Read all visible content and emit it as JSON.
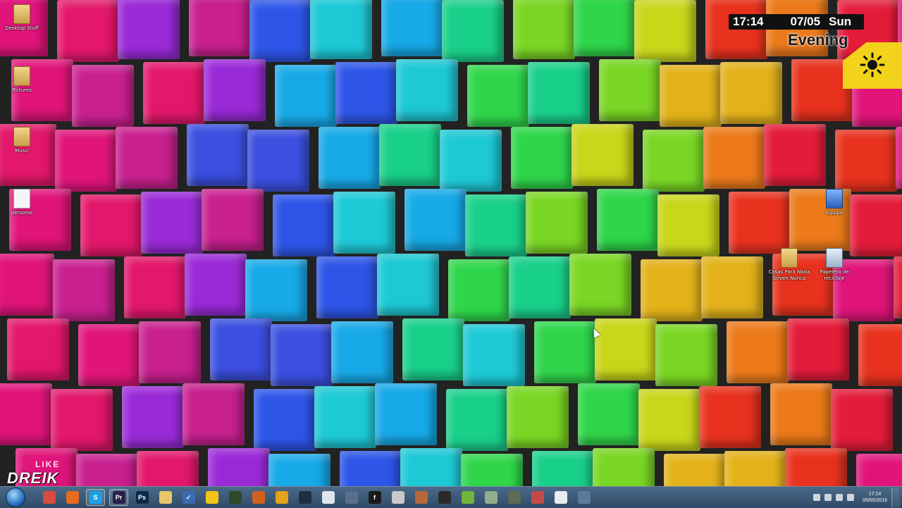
{
  "desktop": {
    "icons_left": [
      {
        "label": "Desktop Stuff",
        "icon": "folder-icon"
      },
      {
        "label": "Pictures",
        "icon": "folder-icon"
      },
      {
        "label": "Music",
        "icon": "folder-icon"
      },
      {
        "label": "personal",
        "icon": "document-icon"
      }
    ],
    "icons_right": [
      {
        "label": "Equipo",
        "icon": "computer-icon"
      },
      {
        "label": "Cosas Para Nada Sirven Nunca",
        "icon": "folder-icon"
      },
      {
        "label": "Papelera de reciclaje",
        "icon": "recycle-bin-icon"
      }
    ]
  },
  "clock_widget": {
    "time": "17:14",
    "date": "07/05",
    "day": "Sun",
    "greeting": "Evening",
    "weather_icon": "sun-icon",
    "badge_color": "#f2d21a"
  },
  "watermark": {
    "top_text": "LIKE",
    "brand": "DREIK"
  },
  "taskbar": {
    "start_icon": "windows-start-orb",
    "apps": [
      {
        "name": "chrome-icon",
        "glyph": "",
        "color": "#d94b3a"
      },
      {
        "name": "firefox-icon",
        "glyph": "",
        "color": "#e56b1f"
      },
      {
        "name": "skype-icon",
        "glyph": "S",
        "color": "#1aa0e6",
        "active": true
      },
      {
        "name": "premiere-icon",
        "glyph": "Pr",
        "color": "#2a1f4a",
        "active": true
      },
      {
        "name": "photoshop-icon",
        "glyph": "Ps",
        "color": "#0b2a4a"
      },
      {
        "name": "folder-icon",
        "glyph": "",
        "color": "#e8c76a"
      },
      {
        "name": "checkmark-icon",
        "glyph": "✓",
        "color": "#3b6bb3"
      },
      {
        "name": "idea-icon",
        "glyph": "",
        "color": "#f3c419"
      },
      {
        "name": "video-icon",
        "glyph": "",
        "color": "#2d4a2a"
      },
      {
        "name": "basketball-icon",
        "glyph": "",
        "color": "#d0611f"
      },
      {
        "name": "lock-icon",
        "glyph": "",
        "color": "#e2a21a"
      },
      {
        "name": "terminal-icon",
        "glyph": "",
        "color": "#1d3042"
      },
      {
        "name": "document-icon",
        "glyph": "",
        "color": "#dfe6ef"
      },
      {
        "name": "tool-icon",
        "glyph": "",
        "color": "#5a6f8a"
      },
      {
        "name": "flash-icon",
        "glyph": "f",
        "color": "#1a1a1a"
      },
      {
        "name": "camera-icon",
        "glyph": "",
        "color": "#c8c8c8"
      },
      {
        "name": "cookie-icon",
        "glyph": "",
        "color": "#b8673a"
      },
      {
        "name": "gamepad-icon",
        "glyph": "",
        "color": "#2a2a2a"
      },
      {
        "name": "phone-icon",
        "glyph": "",
        "color": "#6fb63a"
      },
      {
        "name": "network-icon",
        "glyph": "",
        "color": "#8fae8a"
      },
      {
        "name": "box-icon",
        "glyph": "",
        "color": "#5f6b55"
      },
      {
        "name": "web-icon",
        "glyph": "",
        "color": "#c44a4a"
      },
      {
        "name": "notepad-icon",
        "glyph": "",
        "color": "#e9edf2"
      },
      {
        "name": "globe-icon",
        "glyph": "",
        "color": "#5a7a9a"
      }
    ],
    "tray_time": "17:14",
    "tray_date": "05/05/2015"
  }
}
